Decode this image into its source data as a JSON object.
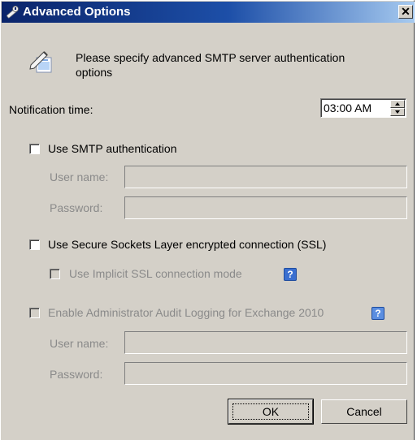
{
  "window": {
    "title": "Advanced Options",
    "close_glyph": "✕",
    "title_icon": "wrench-icon"
  },
  "header": {
    "icon": "notes-pen-icon",
    "text": "Please specify advanced SMTP server authentication options"
  },
  "notification": {
    "label": "Notification time:",
    "value": "03:00 AM"
  },
  "smtp_auth": {
    "checkbox_label": "Use SMTP authentication",
    "checked": false,
    "username_label": "User name:",
    "username_value": "",
    "password_label": "Password:",
    "password_value": ""
  },
  "ssl": {
    "checkbox_label": "Use Secure Sockets Layer encrypted connection (SSL)",
    "checked": false,
    "implicit_label": "Use Implicit SSL connection mode",
    "implicit_checked": false,
    "implicit_enabled": false,
    "help_glyph": "?"
  },
  "audit": {
    "checkbox_label": "Enable Administrator Audit Logging for Exchange 2010",
    "checked": false,
    "enabled": false,
    "help_glyph": "?",
    "username_label": "User name:",
    "username_value": "",
    "password_label": "Password:",
    "password_value": ""
  },
  "buttons": {
    "ok": "OK",
    "cancel": "Cancel"
  }
}
